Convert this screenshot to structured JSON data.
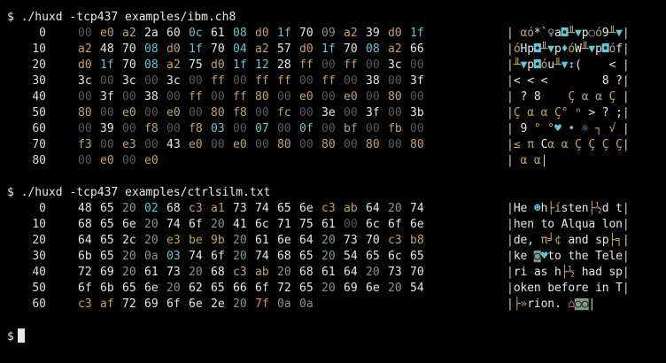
{
  "terminal": {
    "prompt": "$",
    "colors": {
      "background": "#000000",
      "null": "#5a5a5a",
      "printable": "#e6e6e6",
      "whitespace": "#7c9c88",
      "control": "#c8a25a",
      "high": "#5cc8d8",
      "del": "#f07a7a"
    },
    "blocks": [
      {
        "command": "./huxd -tcp437 examples/ibm.ch8",
        "rows": [
          {
            "offset": "0",
            "bytes": [
              "00",
              "e0",
              "a2",
              "2a",
              "60",
              "0c",
              "61",
              "08",
              "d0",
              "1f",
              "70",
              "09",
              "a2",
              "39",
              "d0",
              "1f"
            ],
            "ascii": " αó*`♀a◘╨▼p○ó9╨▼"
          },
          {
            "offset": "10",
            "bytes": [
              "a2",
              "48",
              "70",
              "08",
              "d0",
              "1f",
              "70",
              "04",
              "a2",
              "57",
              "d0",
              "1f",
              "70",
              "08",
              "a2",
              "66"
            ],
            "ascii": "óHp◘╨▼p♦óW╨▼p◘óf"
          },
          {
            "offset": "20",
            "bytes": [
              "d0",
              "1f",
              "70",
              "08",
              "a2",
              "75",
              "d0",
              "1f",
              "12",
              "28",
              "ff",
              "00",
              "ff",
              "00",
              "3c",
              "00"
            ],
            "ascii": "╨▼p◘óu╨▼↕(    < "
          },
          {
            "offset": "30",
            "bytes": [
              "3c",
              "00",
              "3c",
              "00",
              "3c",
              "00",
              "ff",
              "00",
              "ff",
              "ff",
              "00",
              "ff",
              "00",
              "38",
              "00",
              "3f"
            ],
            "ascii": "< < <        8 ?"
          },
          {
            "offset": "40",
            "bytes": [
              "00",
              "3f",
              "00",
              "38",
              "00",
              "ff",
              "00",
              "ff",
              "80",
              "00",
              "e0",
              "00",
              "e0",
              "00",
              "80",
              "00"
            ],
            "ascii": " ? 8    Ç α α Ç "
          },
          {
            "offset": "50",
            "bytes": [
              "80",
              "00",
              "e0",
              "00",
              "e0",
              "00",
              "80",
              "f8",
              "00",
              "fc",
              "00",
              "3e",
              "00",
              "3f",
              "00",
              "3b"
            ],
            "ascii": "Ç α α Ç° ⁿ > ? ;"
          },
          {
            "offset": "60",
            "bytes": [
              "00",
              "39",
              "00",
              "f8",
              "00",
              "f8",
              "03",
              "00",
              "07",
              "00",
              "0f",
              "00",
              "bf",
              "00",
              "fb",
              "00"
            ],
            "ascii": " 9 ° °♥ • ☼ ┐ √ "
          },
          {
            "offset": "70",
            "bytes": [
              "f3",
              "00",
              "e3",
              "00",
              "43",
              "e0",
              "00",
              "e0",
              "00",
              "80",
              "00",
              "80",
              "00",
              "80",
              "00",
              "80"
            ],
            "ascii": "≤ π Cα α Ç Ç Ç Ç"
          },
          {
            "offset": "80",
            "bytes": [
              "00",
              "e0",
              "00",
              "e0"
            ],
            "ascii": " α α"
          }
        ]
      },
      {
        "command": "./huxd -tcp437 examples/ctrlsilm.txt",
        "rows": [
          {
            "offset": "0",
            "bytes": [
              "48",
              "65",
              "20",
              "02",
              "68",
              "c3",
              "a1",
              "73",
              "74",
              "65",
              "6e",
              "c3",
              "ab",
              "64",
              "20",
              "74"
            ],
            "ascii": "He ☻h├ísten├½d t"
          },
          {
            "offset": "10",
            "bytes": [
              "68",
              "65",
              "6e",
              "20",
              "74",
              "6f",
              "20",
              "41",
              "6c",
              "71",
              "75",
              "61",
              "00",
              "6c",
              "6f",
              "6e"
            ],
            "ascii": "hen to Alqua lon"
          },
          {
            "offset": "20",
            "bytes": [
              "64",
              "65",
              "2c",
              "20",
              "e3",
              "be",
              "9b",
              "20",
              "61",
              "6e",
              "64",
              "20",
              "73",
              "70",
              "c3",
              "b8"
            ],
            "ascii": "de, π╛¢ and sp├╕"
          },
          {
            "offset": "30",
            "bytes": [
              "6b",
              "65",
              "20",
              "0a",
              "03",
              "74",
              "6f",
              "20",
              "74",
              "68",
              "65",
              "20",
              "54",
              "65",
              "6c",
              "65"
            ],
            "ascii": "ke ◙♥to the Tele"
          },
          {
            "offset": "40",
            "bytes": [
              "72",
              "69",
              "20",
              "61",
              "73",
              "20",
              "68",
              "c3",
              "ab",
              "20",
              "68",
              "61",
              "64",
              "20",
              "73",
              "70"
            ],
            "ascii": "ri as h├½ had sp"
          },
          {
            "offset": "50",
            "bytes": [
              "6f",
              "6b",
              "65",
              "6e",
              "20",
              "62",
              "65",
              "66",
              "6f",
              "72",
              "65",
              "20",
              "69",
              "6e",
              "20",
              "54"
            ],
            "ascii": "oken before in T"
          },
          {
            "offset": "60",
            "bytes": [
              "c3",
              "af",
              "72",
              "69",
              "6f",
              "6e",
              "2e",
              "20",
              "7f",
              "0a",
              "0a"
            ],
            "ascii": "├»rion. ⌂◙◙"
          }
        ]
      }
    ]
  }
}
